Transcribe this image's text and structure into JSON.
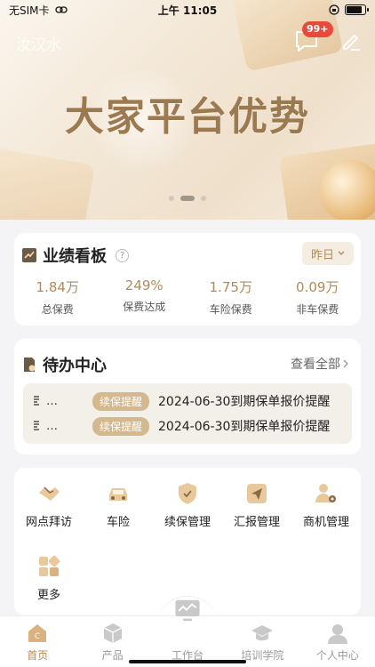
{
  "status_bar": {
    "carrier": "无SIM卡",
    "time": "上午 11:05",
    "battery_level": 0.9
  },
  "banner": {
    "user_name": "汝汉水",
    "title": "大家平台优势",
    "badge": "99+",
    "slide_index": 2,
    "slide_count": 3
  },
  "performance": {
    "title": "业绩看板",
    "help": "?",
    "range_label": "昨日",
    "stats": [
      {
        "value": "1.84万",
        "label": "总保费"
      },
      {
        "value": "249%",
        "label": "保费达成"
      },
      {
        "value": "1.75万",
        "label": "车险保费"
      },
      {
        "value": "0.09万",
        "label": "非车保费"
      }
    ]
  },
  "todo": {
    "title": "待办中心",
    "view_all": "查看全部",
    "items": [
      {
        "lead": "…",
        "tag": "续保提醒",
        "text": "2024-06-30到期保单报价提醒"
      },
      {
        "lead": "…",
        "tag": "续保提醒",
        "text": "2024-06-30到期保单报价提醒"
      }
    ]
  },
  "shortcuts": [
    {
      "label": "网点拜访",
      "icon": "handshake-icon"
    },
    {
      "label": "车险",
      "icon": "car-icon"
    },
    {
      "label": "续保管理",
      "icon": "shield-icon"
    },
    {
      "label": "汇报管理",
      "icon": "send-icon"
    },
    {
      "label": "商机管理",
      "icon": "user-gear-icon"
    },
    {
      "label": "更多",
      "icon": "grid-icon"
    }
  ],
  "tabs": [
    {
      "label": "首页",
      "icon": "home-icon",
      "active": true
    },
    {
      "label": "产品",
      "icon": "box-icon",
      "active": false
    },
    {
      "label": "工作台",
      "icon": "monitor-icon",
      "active": false
    },
    {
      "label": "培训学院",
      "icon": "graduation-cap-icon",
      "active": false
    },
    {
      "label": "个人中心",
      "icon": "person-icon",
      "active": false
    }
  ],
  "colors": {
    "accent": "#b28a58",
    "badge": "#e74a3b",
    "tag": "#d6b88e"
  }
}
